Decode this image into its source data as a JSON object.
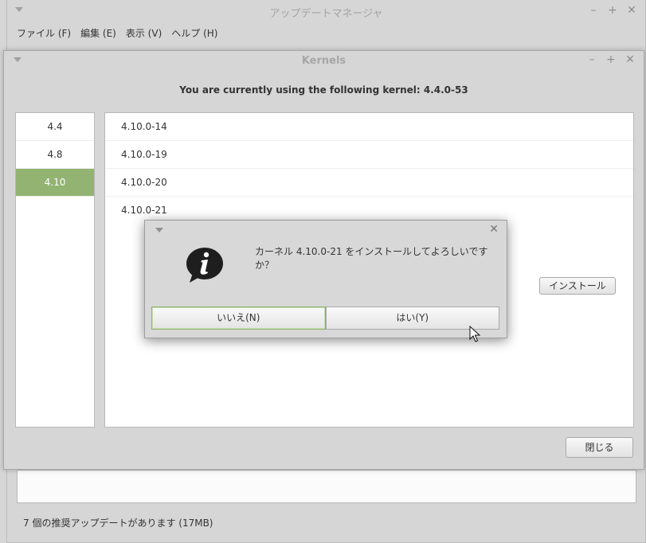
{
  "update_manager": {
    "title": "アップデートマネージャ",
    "menu": [
      "ファイル (F)",
      "編集 (E)",
      "表示 (V)",
      "ヘルプ (H)"
    ],
    "status": "7 個の推奨アップデートがあります (17MB)"
  },
  "kernels_window": {
    "title": "Kernels",
    "heading": "You are currently using the following kernel: 4.4.0-53",
    "series": [
      {
        "label": "4.4",
        "selected": false
      },
      {
        "label": "4.8",
        "selected": false
      },
      {
        "label": "4.10",
        "selected": true
      }
    ],
    "kernels": [
      "4.10.0-14",
      "4.10.0-19",
      "4.10.0-20",
      "4.10.0-21"
    ],
    "install_label": "インストール",
    "close_label": "閉じる"
  },
  "dialog": {
    "message": "カーネル 4.10.0-21 をインストールしてよろしいですか？",
    "no_label": "いいえ(N)",
    "yes_label": "はい(Y)"
  },
  "window_controls": {
    "minimize": "–",
    "maximize": "+",
    "close": "✕"
  },
  "colors": {
    "selection": "#92b372",
    "default_border": "#8bb36a"
  }
}
